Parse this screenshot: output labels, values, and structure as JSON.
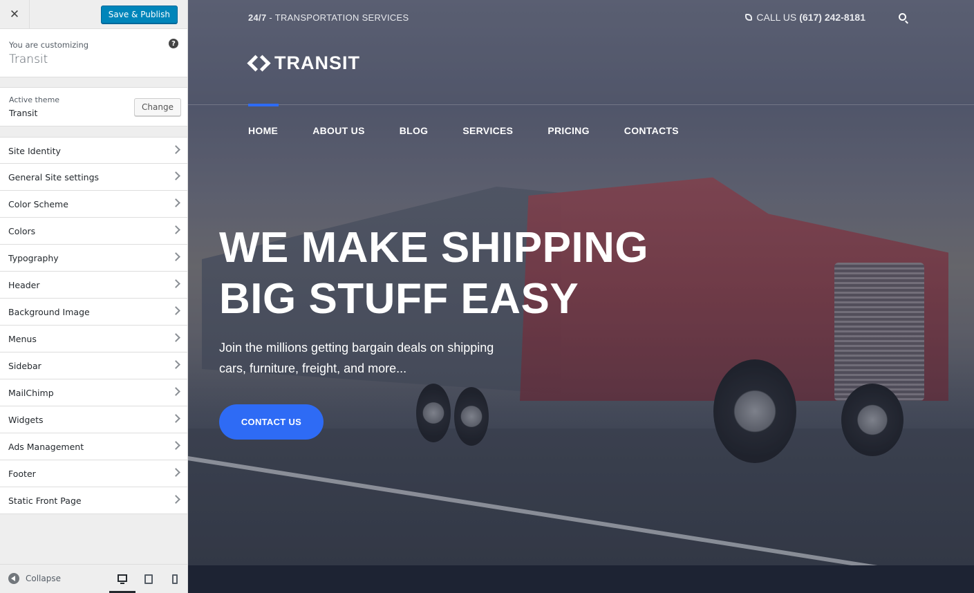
{
  "customizer": {
    "close_symbol": "✕",
    "publish_label": "Save & Publish",
    "info": {
      "small": "You are customizing",
      "title": "Transit",
      "help": "?"
    },
    "theme": {
      "small": "Active theme",
      "name": "Transit",
      "change_label": "Change"
    },
    "sections": [
      "Site Identity",
      "General Site settings",
      "Color Scheme",
      "Colors",
      "Typography",
      "Header",
      "Background Image",
      "Menus",
      "Sidebar",
      "MailChimp",
      "Widgets",
      "Ads Management",
      "Footer",
      "Static Front Page"
    ],
    "collapse_label": "Collapse"
  },
  "site": {
    "topbar": {
      "bold": "24/7",
      "rest": " - TRANSPORTATION SERVICES",
      "call_label": "CALL US",
      "phone": "(617) 242-8181"
    },
    "logo": "TRANSIT",
    "nav": [
      "HOME",
      "ABOUT US",
      "BLOG",
      "SERVICES",
      "PRICING",
      "CONTACTS"
    ],
    "hero": {
      "line1": "WE MAKE SHIPPING",
      "line2": "BIG STUFF EASY",
      "subtext": "Join the millions getting bargain deals on shipping cars, furniture, freight, and more...",
      "cta": "CONTACT US"
    }
  },
  "colors": {
    "accent": "#2e6bf5",
    "publish": "#0085ba"
  }
}
